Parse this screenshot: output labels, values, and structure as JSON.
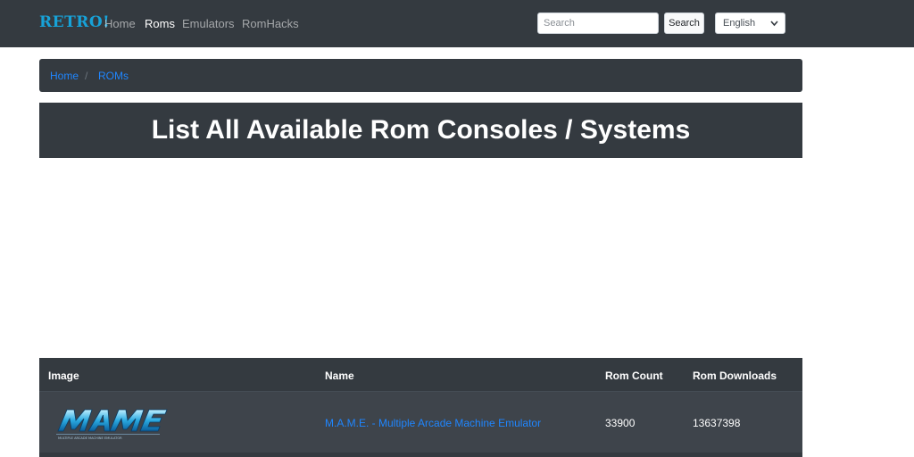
{
  "brand": "RETRO!",
  "nav": {
    "home": "Home",
    "roms": "Roms",
    "emulators": "Emulators",
    "romhacks": "RomHacks"
  },
  "search": {
    "placeholder": "Search",
    "button_label": "Search"
  },
  "language": {
    "selected": "English"
  },
  "breadcrumb": {
    "home": "Home",
    "separator": "/",
    "current": "ROMs"
  },
  "page_title": "List All Available Rom Consoles / Systems",
  "table": {
    "headers": {
      "image": "Image",
      "name": "Name",
      "rom_count": "Rom Count",
      "rom_downloads": "Rom Downloads"
    },
    "rows": [
      {
        "logo_icon": "mame-logo",
        "logo_text": "MAME",
        "logo_subtext": "MULTIPLE ARCADE MACHINE EMULATOR",
        "name": "M.A.M.E. - Multiple Arcade Machine Emulator",
        "rom_count": "33900",
        "rom_downloads": "13637398"
      }
    ]
  },
  "colors": {
    "navbar": "#343a40",
    "brand": "#17a2d8",
    "link": "#1f86ff",
    "row_bg": "#3e444b"
  }
}
